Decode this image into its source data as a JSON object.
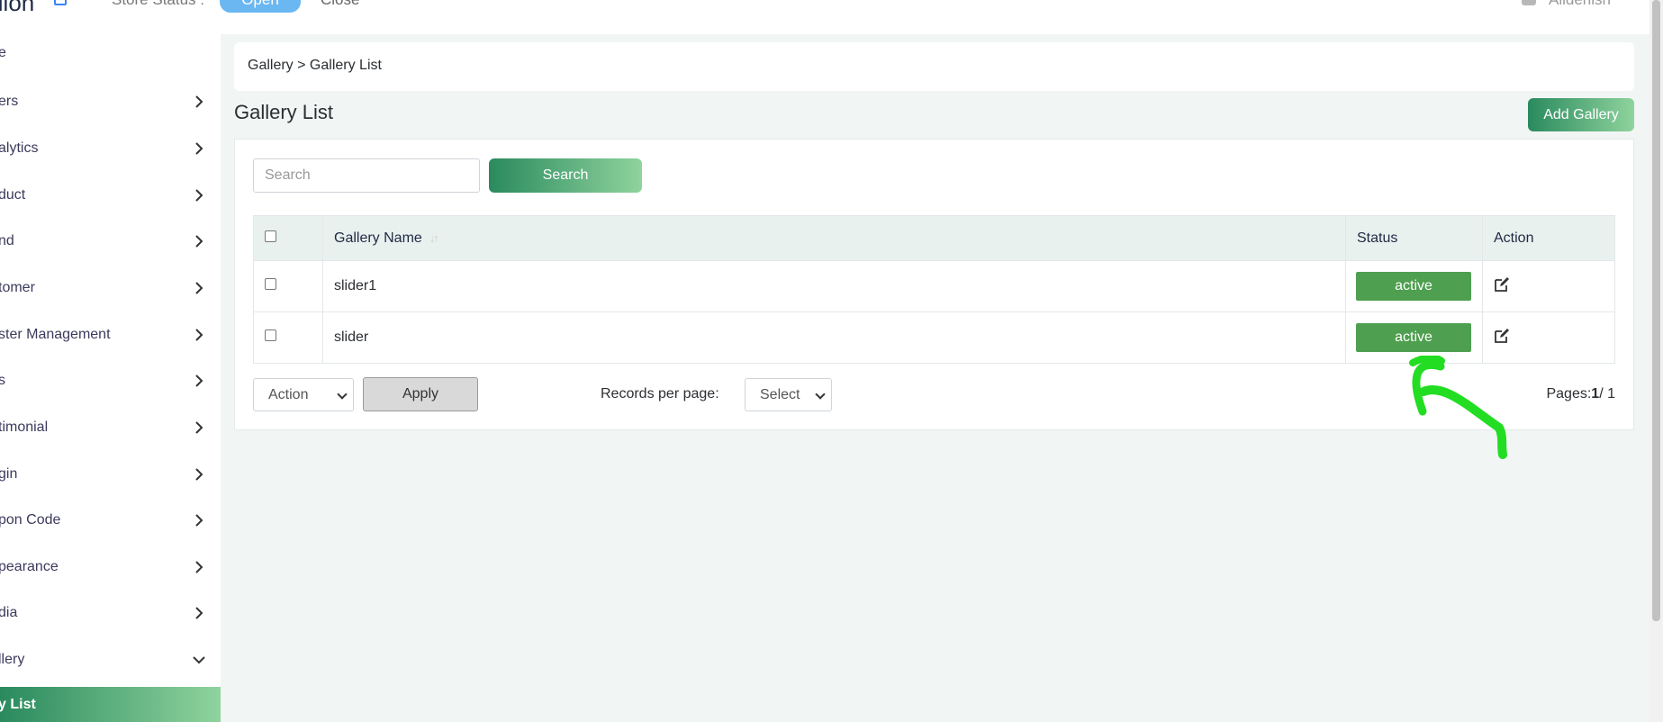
{
  "topbar": {
    "brand": "ilion",
    "store_status_label": "Store Status :",
    "open_label": "Open",
    "close_label": "Close",
    "user_name": "Alldenish"
  },
  "sidebar": {
    "items": [
      {
        "label": "e",
        "has_chevron": false
      },
      {
        "label": "ers",
        "has_chevron": true
      },
      {
        "label": "alytics",
        "has_chevron": true
      },
      {
        "label": "duct",
        "has_chevron": true
      },
      {
        "label": "nd",
        "has_chevron": true
      },
      {
        "label": "tomer",
        "has_chevron": true
      },
      {
        "label": "ster Management",
        "has_chevron": true
      },
      {
        "label": "s",
        "has_chevron": true
      },
      {
        "label": "timonial",
        "has_chevron": true
      },
      {
        "label": "gin",
        "has_chevron": true
      },
      {
        "label": "pon Code",
        "has_chevron": true
      },
      {
        "label": "pearance",
        "has_chevron": true
      },
      {
        "label": "dia",
        "has_chevron": true
      },
      {
        "label": "llery",
        "has_chevron": true,
        "expanded": true
      }
    ],
    "active_item": "y List"
  },
  "breadcrumb": "Gallery > Gallery List",
  "page_title": "Gallery List",
  "add_button": "Add Gallery",
  "search": {
    "placeholder": "Search",
    "button": "Search"
  },
  "table": {
    "columns": [
      "Gallery Name",
      "Status",
      "Action"
    ],
    "rows": [
      {
        "name": "slider1",
        "status": "active"
      },
      {
        "name": "slider",
        "status": "active"
      }
    ]
  },
  "footer": {
    "action_select": "Action",
    "apply_button": "Apply",
    "records_per_page_label": "Records per page:",
    "records_select": "Select",
    "pages_label": "Pages:",
    "current_page": "1",
    "total_pages": "/ 1"
  },
  "colors": {
    "accent_gradient_start": "#2a8a5e",
    "accent_gradient_end": "#8fd39d",
    "status_active": "#4e9f4f",
    "annotation": "#22dd22"
  }
}
